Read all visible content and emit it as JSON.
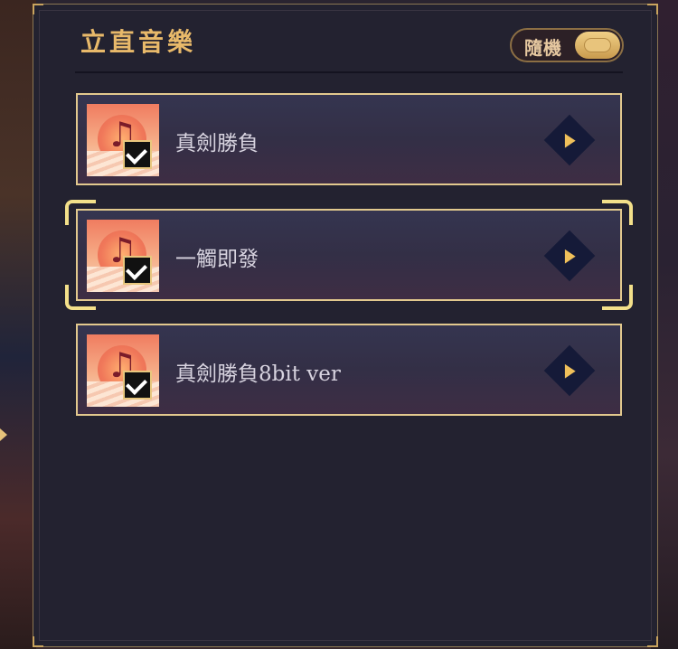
{
  "header": {
    "title": "立直音樂"
  },
  "shuffle": {
    "label": "隨機",
    "enabled": true
  },
  "songs": [
    {
      "title": "真劍勝負",
      "checked": true,
      "selected": false
    },
    {
      "title": "一觸即發",
      "checked": true,
      "selected": true
    },
    {
      "title": "真劍勝負8bit ver",
      "checked": true,
      "selected": false
    }
  ],
  "colors": {
    "accent": "#e8b96a",
    "border": "#e2c98e",
    "play_bg": "#151a38",
    "play_arrow": "#f0c05a"
  },
  "icons": {
    "album": "music-note-icon",
    "check": "checkmark-icon",
    "play": "play-icon"
  }
}
